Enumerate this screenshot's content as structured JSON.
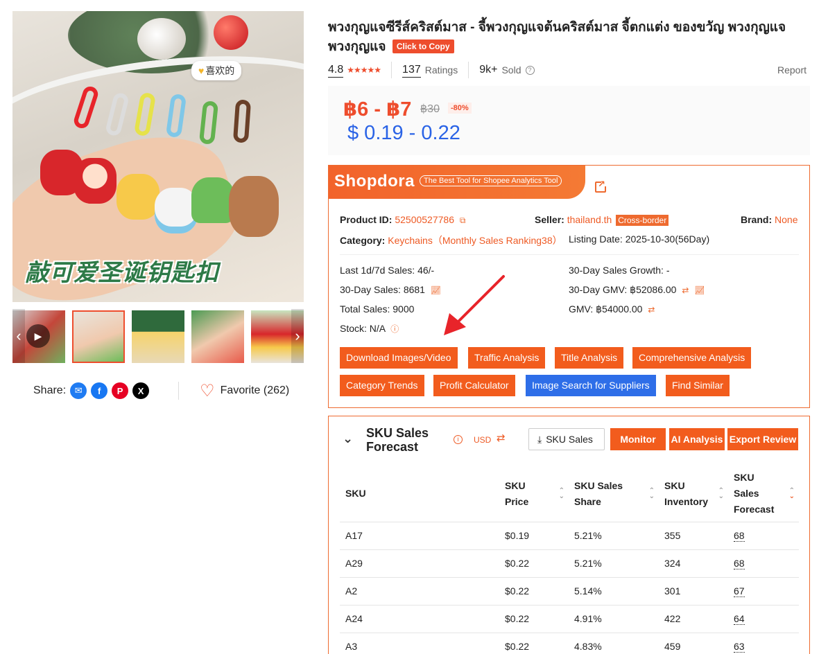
{
  "gallery": {
    "badge_text": "喜欢的",
    "caption": "敲可爱圣诞钥匙扣"
  },
  "share": {
    "label": "Share:",
    "networks": [
      "messenger",
      "facebook",
      "pinterest",
      "x"
    ],
    "favorite_label": "Favorite (262)"
  },
  "product": {
    "title": "พวงกุญแจซีรีส์คริสต์มาส - จี้พวงกุญแจต้นคริสต์มาส จี้ตกแต่ง ของขวัญ พวงกุญแจ พวงกุญแจ",
    "copy_label": "Click to Copy",
    "rating": "4.8",
    "ratings_count": "137",
    "ratings_label": "Ratings",
    "sold_count": "9k+",
    "sold_label": "Sold",
    "report_label": "Report",
    "price_range": "฿6 - ฿7",
    "price_original": "฿30",
    "discount": "-80%",
    "price_usd": "$ 0.19 - 0.22"
  },
  "shopdora": {
    "logo": "Shopdora",
    "tagline": "The Best Tool for Shopee Analytics Tool",
    "product_id_label": "Product ID:",
    "product_id": "52500527786",
    "seller_label": "Seller:",
    "seller": "thailand.th",
    "seller_badge": "Cross-border",
    "brand_label": "Brand:",
    "brand": "None",
    "category_label": "Category:",
    "category": "Keychains（Monthly Sales Ranking38）",
    "listing_date": "Listing Date: 2025-10-30(56Day)",
    "last_sales": "Last 1d/7d Sales: 46/-",
    "growth": "30-Day Sales Growth: -",
    "sales_30": "30-Day Sales: 8681",
    "gmv_30": "30-Day GMV: ฿52086.00",
    "total_sales": "Total Sales: 9000",
    "gmv": "GMV: ฿54000.00",
    "stock": "Stock: N/A",
    "buttons": [
      "Download Images/Video",
      "Traffic Analysis",
      "Title Analysis",
      "Comprehensive Analysis",
      "Category Trends",
      "Profit Calculator",
      "Image Search for Suppliers",
      "Find Similar"
    ],
    "highlight_color": "#2e6ee8",
    "accent_color": "#f25c1d"
  },
  "sku": {
    "title": "SKU Sales Forecast",
    "currency": "USD",
    "sku_sales_btn": "SKU Sales",
    "monitor_btn": "Monitor",
    "ai_btn": "AI Analysis",
    "export_btn": "Export Review",
    "columns": [
      "SKU",
      "SKU Price",
      "SKU Sales Share",
      "SKU Inventory",
      "SKU Sales Forecast"
    ],
    "rows": [
      {
        "sku": "A17",
        "price": "$0.19",
        "share": "5.21%",
        "inventory": "355",
        "forecast": "68"
      },
      {
        "sku": "A29",
        "price": "$0.22",
        "share": "5.21%",
        "inventory": "324",
        "forecast": "68"
      },
      {
        "sku": "A2",
        "price": "$0.22",
        "share": "5.14%",
        "inventory": "301",
        "forecast": "67"
      },
      {
        "sku": "A24",
        "price": "$0.22",
        "share": "4.91%",
        "inventory": "422",
        "forecast": "64"
      },
      {
        "sku": "A3",
        "price": "$0.22",
        "share": "4.83%",
        "inventory": "459",
        "forecast": "63"
      }
    ]
  }
}
